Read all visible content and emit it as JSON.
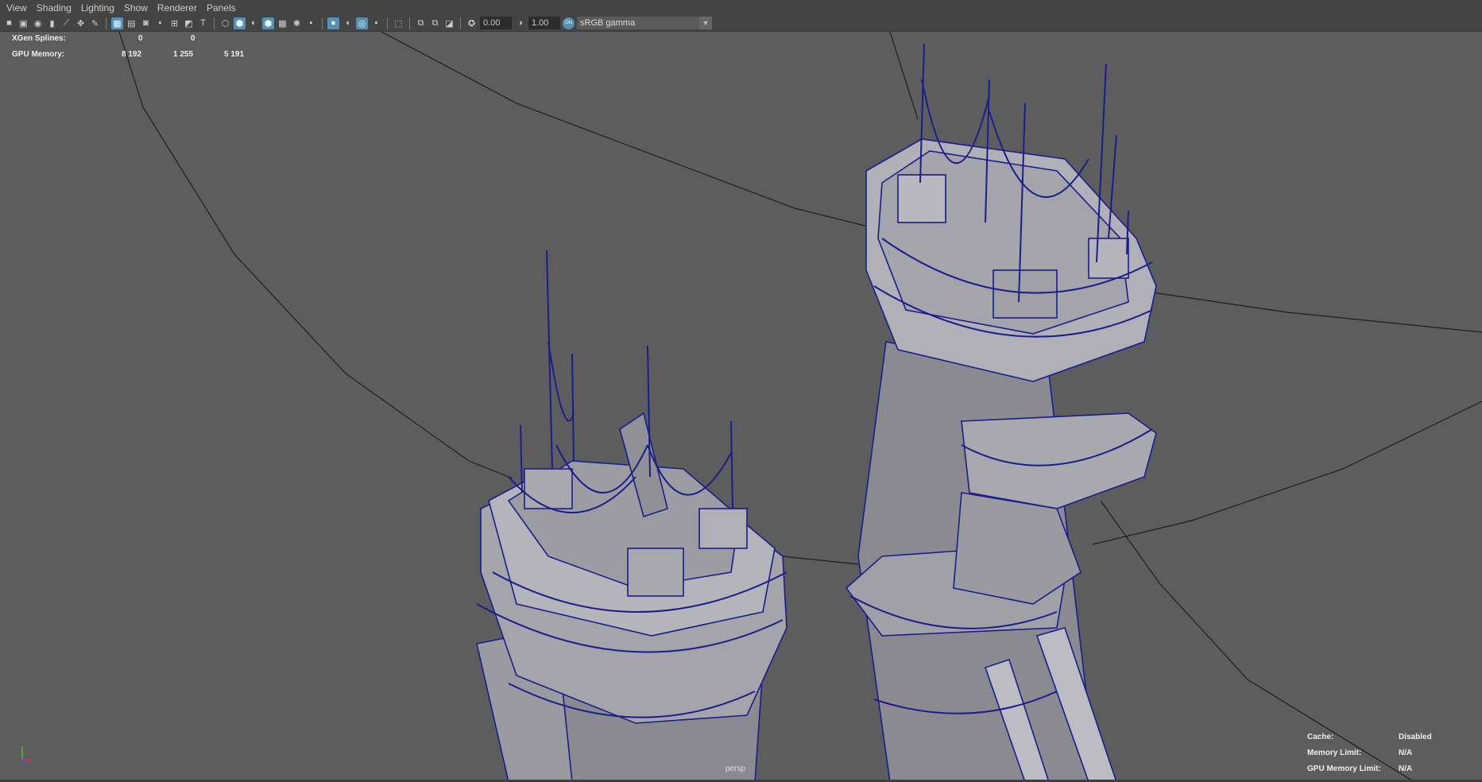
{
  "menu": [
    "View",
    "Shading",
    "Lighting",
    "Show",
    "Renderer",
    "Panels"
  ],
  "toolbar": {
    "exposure": "0.00",
    "gamma": "1.00",
    "color_space": "sRGB gamma",
    "cm_badge": "ON"
  },
  "hud_top": {
    "xgen_label": "XGen Splines:",
    "xgen_values": [
      "0",
      "0"
    ],
    "gpu_label": "GPU Memory:",
    "gpu_values": [
      "8 192",
      "1 255",
      "5 191"
    ]
  },
  "hud_bottom": {
    "cache_label": "Cache:",
    "cache_value": "Disabled",
    "mem_label": "Memory Limit:",
    "mem_value": "N/A",
    "gpu_label": "GPU Memory Limit:",
    "gpu_value": "N/A"
  },
  "camera": "persp",
  "colors": {
    "wire": "#1c1c8c",
    "mesh": "#8f8f95",
    "bg": "#5d5d5d",
    "active": "#5b8fb0"
  }
}
